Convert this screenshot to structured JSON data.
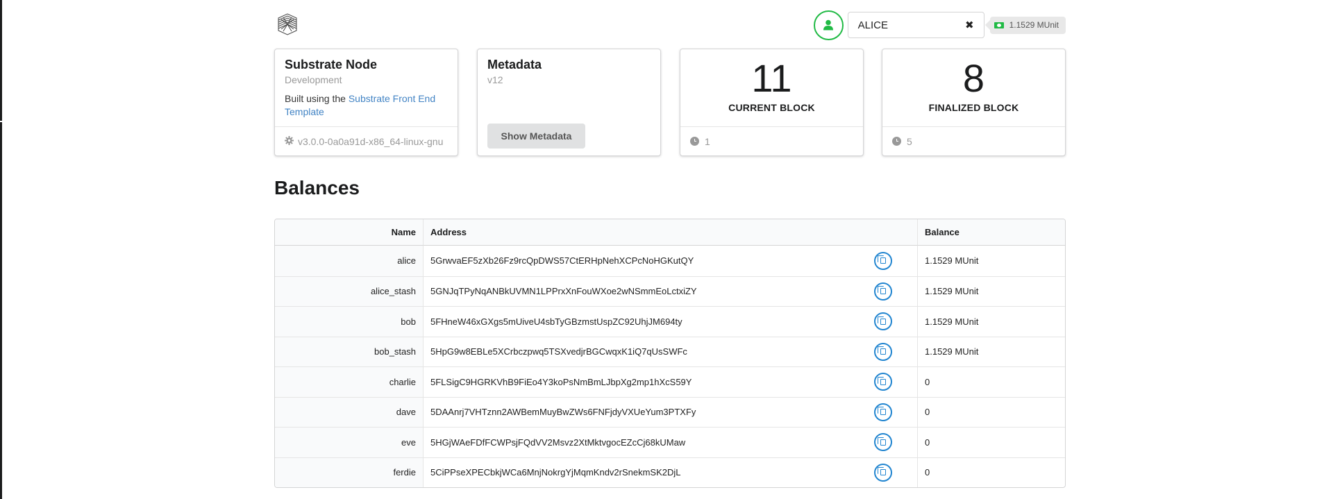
{
  "header": {
    "account_name": "ALICE",
    "balance": "1.1529 MUnit",
    "icons": {
      "logo": "substrate-logo",
      "avatar": "user-icon",
      "clear": "close-icon",
      "money": "money-icon"
    },
    "accent_color": "#21ba45"
  },
  "cards": {
    "node": {
      "title": "Substrate Node",
      "meta": "Development",
      "desc_prefix": "Built using the ",
      "desc_link": "Substrate Front End Template",
      "version": "v3.0.0-0a0a91d-x86_64-linux-gnu"
    },
    "metadata": {
      "title": "Metadata",
      "meta": "v12",
      "button_label": "Show Metadata"
    },
    "current_block": {
      "value": "11",
      "label": "CURRENT BLOCK",
      "timer": "1"
    },
    "finalized_block": {
      "value": "8",
      "label": "FINALIZED BLOCK",
      "timer": "5"
    }
  },
  "balances": {
    "title": "Balances",
    "columns": [
      "Name",
      "Address",
      "Balance"
    ],
    "rows": [
      {
        "name": "alice",
        "address": "5GrwvaEF5zXb26Fz9rcQpDWS57CtERHpNehXCPcNoHGKutQY",
        "balance": "1.1529 MUnit"
      },
      {
        "name": "alice_stash",
        "address": "5GNJqTPyNqANBkUVMN1LPPrxXnFouWXoe2wNSmmEoLctxiZY",
        "balance": "1.1529 MUnit"
      },
      {
        "name": "bob",
        "address": "5FHneW46xGXgs5mUiveU4sbTyGBzmstUspZC92UhjJM694ty",
        "balance": "1.1529 MUnit"
      },
      {
        "name": "bob_stash",
        "address": "5HpG9w8EBLe5XCrbczpwq5TSXvedjrBGCwqxK1iQ7qUsSWFc",
        "balance": "1.1529 MUnit"
      },
      {
        "name": "charlie",
        "address": "5FLSigC9HGRKVhB9FiEo4Y3koPsNmBmLJbpXg2mp1hXcS59Y",
        "balance": "0"
      },
      {
        "name": "dave",
        "address": "5DAAnrj7VHTznn2AWBemMuyBwZWs6FNFjdyVXUeYum3PTXFy",
        "balance": "0"
      },
      {
        "name": "eve",
        "address": "5HGjWAeFDfFCWPsjFQdVV2Msvz2XtMktvgocEZcCj68kUMaw",
        "balance": "0"
      },
      {
        "name": "ferdie",
        "address": "5CiPPseXPECbkjWCa6MnjNokrgYjMqmKndv2rSnekmSK2DjL",
        "balance": "0"
      }
    ]
  }
}
